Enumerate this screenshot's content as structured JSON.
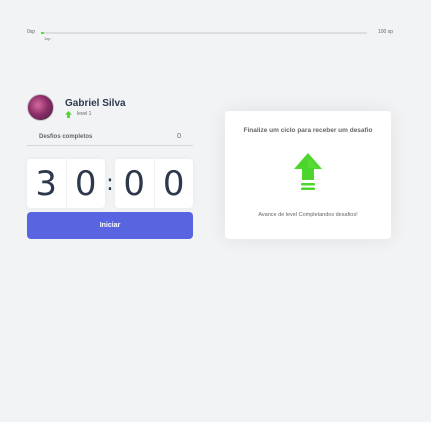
{
  "xp": {
    "start_label": "0xp",
    "end_label": "100 xp",
    "current_label": "1xp",
    "progress_percent": 1
  },
  "profile": {
    "name": "Gabriel Silva",
    "level_label": "level 1",
    "avatar_icon": "avatar-photo"
  },
  "completed": {
    "label": "Desfios completos",
    "value": "0"
  },
  "countdown": {
    "minutes": [
      "3",
      "0"
    ],
    "separator": ":",
    "seconds": [
      "0",
      "0"
    ]
  },
  "start_button": {
    "label": "Iniciar"
  },
  "challenge": {
    "title": "Finalize um ciclo para receber um desafio",
    "icon": "level-up-icon",
    "text": "Avance de level Completandos desafios!"
  },
  "colors": {
    "background": "#f2f3f5",
    "accent": "#5965e0",
    "green": "#4cd62b",
    "title": "#2e384d",
    "text": "#666666"
  }
}
